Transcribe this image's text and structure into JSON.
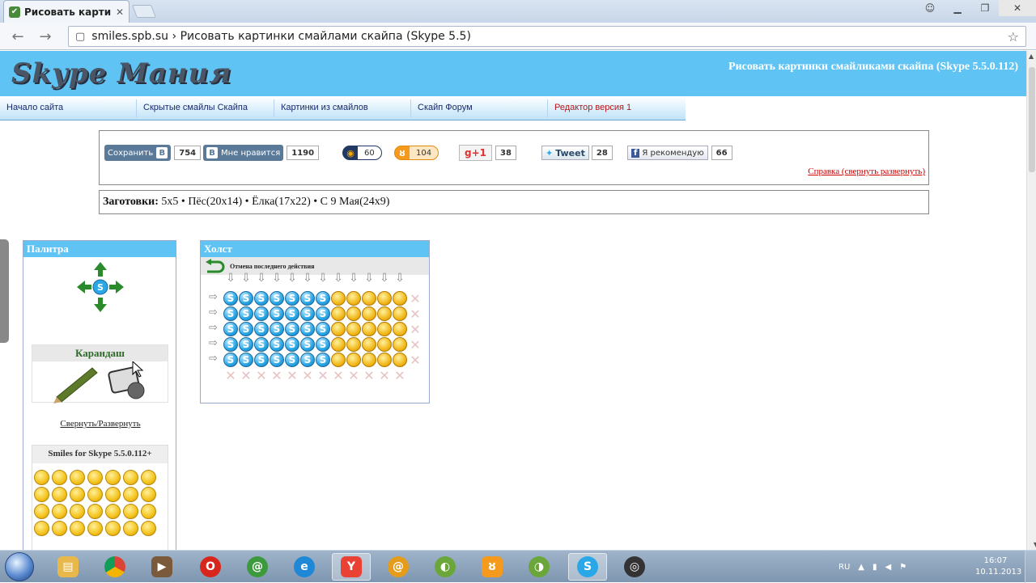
{
  "browser": {
    "tab_title": "Рисовать картинки см",
    "url_host": "smiles.spb.su",
    "url_sep": "›",
    "url_title": "Рисовать картинки смайлами скайпа (Skype 5.5)"
  },
  "site": {
    "logo": "Skype Мания",
    "banner_title": "Рисовать картинки смайликами скайпа (Skype 5.5.0.112)",
    "nav": [
      "Начало сайта",
      "Скрытые смайлы Скайпа",
      "Картинки из смайлов",
      "Скайп Форум",
      "Редактор версия 1"
    ],
    "accent": "#5fc4f3"
  },
  "share": {
    "vk_save_label": "Сохранить",
    "vk_save_icon": "В",
    "vk_save_count": "754",
    "vk_like_icon": "В",
    "vk_like_label": "Мне нравится",
    "vk_like_count": "1190",
    "mailru_count": "60",
    "ok_count": "104",
    "gplus_label": "g+1",
    "gplus_count": "38",
    "tweet_label": "Tweet",
    "tweet_count": "28",
    "fb_label": "Я рекомендую",
    "fb_count": "66",
    "help_link": "Справка (свернуть развернуть)"
  },
  "presets": {
    "label": "Заготовки:",
    "items": "5x5 • Пёс(20x14) • Ёлка(17x22) • С 9 Мая(24x9)"
  },
  "palette": {
    "title": "Палитра",
    "pencil_label": "Карандаш",
    "collapse_link": "Свернуть/Развернуть",
    "smiles_title": "Smiles for Skype 5.5.0.112+"
  },
  "canvas": {
    "title": "Холст",
    "undo_label": "Отмена последнего действия"
  },
  "taskbar": {
    "lang": "RU",
    "time": "16:07",
    "date": "10.11.2013"
  }
}
